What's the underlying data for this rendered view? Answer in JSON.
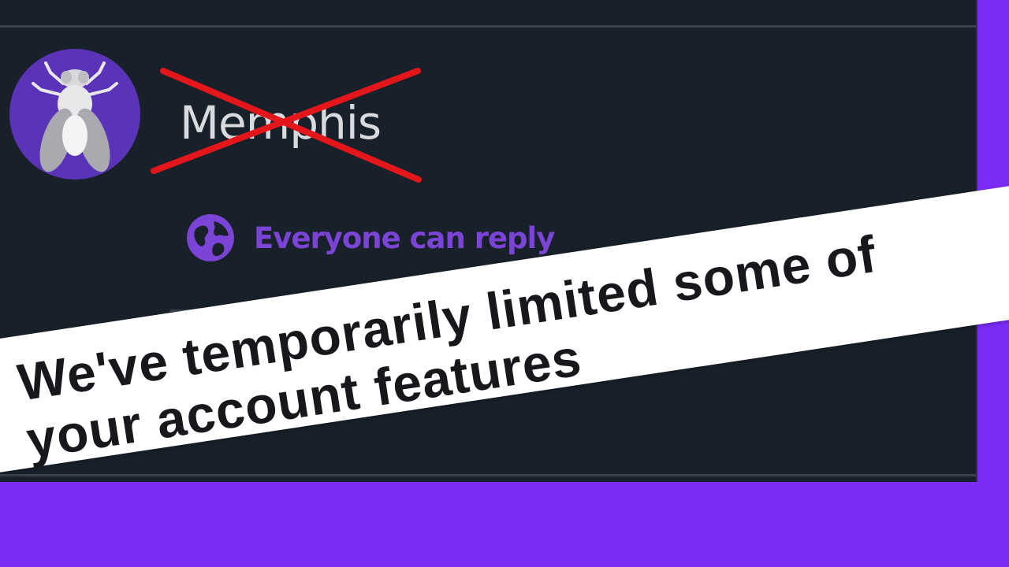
{
  "profile": {
    "username": "Memphis",
    "avatar_icon": "fly-icon",
    "avatar_color": "#5a33b8"
  },
  "reply_setting": {
    "icon": "globe-icon",
    "label": "Everyone can reply",
    "color": "#7b44d6"
  },
  "banner": {
    "message": "We've temporarily limited some of your account features"
  },
  "colors": {
    "background": "#7b2cf5",
    "panel": "#18202a",
    "crossout": "#e3161b"
  }
}
